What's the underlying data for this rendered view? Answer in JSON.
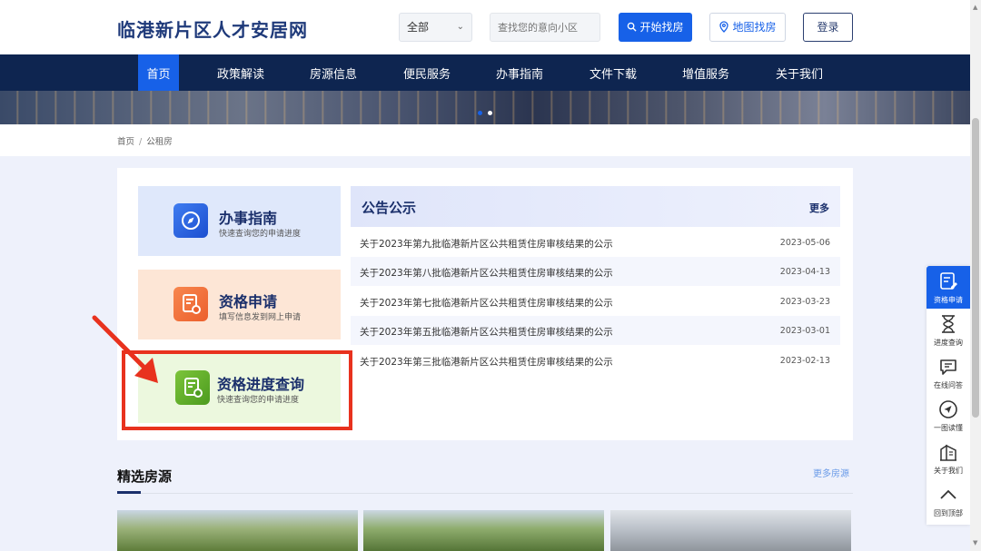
{
  "header": {
    "logo": "临港新片区人才安居网",
    "filter_value": "全部",
    "search_placeholder": "查找您的意向小区",
    "find_button": "开始找房",
    "map_button": "地图找房",
    "login_button": "登录"
  },
  "nav": {
    "items": [
      "首页",
      "政策解读",
      "房源信息",
      "便民服务",
      "办事指南",
      "文件下载",
      "增值服务",
      "关于我们"
    ],
    "active": "首页"
  },
  "breadcrumb": {
    "home": "首页",
    "separator": "/",
    "current": "公租房"
  },
  "cards": [
    {
      "title": "办事指南",
      "subtitle": "快速查询您的申请进度",
      "icon": "compass-icon",
      "bg": "#dfe8fb"
    },
    {
      "title": "资格申请",
      "subtitle": "填写信息发到网上申请",
      "icon": "certificate-icon",
      "bg": "#fde6d6"
    },
    {
      "title": "资格进度查询",
      "subtitle": "快速查询您的申请进度",
      "icon": "certificate-icon",
      "bg": "#ecf8de"
    }
  ],
  "notice": {
    "title": "公告公示",
    "more": "更多",
    "items": [
      {
        "text": "关于2023年第九批临港新片区公共租赁住房审核结果的公示",
        "date": "2023-05-06"
      },
      {
        "text": "关于2023年第八批临港新片区公共租赁住房审核结果的公示",
        "date": "2023-04-13"
      },
      {
        "text": "关于2023年第七批临港新片区公共租赁住房审核结果的公示",
        "date": "2023-03-23"
      },
      {
        "text": "关于2023年第五批临港新片区公共租赁住房审核结果的公示",
        "date": "2023-03-01"
      },
      {
        "text": "关于2023年第三批临港新片区公共租赁住房审核结果的公示",
        "date": "2023-02-13"
      }
    ]
  },
  "featured": {
    "title": "精选房源",
    "more": "更多房源"
  },
  "sidebar": {
    "items": [
      {
        "label": "资格申请",
        "icon": "form-edit-icon"
      },
      {
        "label": "进度查询",
        "icon": "hourglass-icon"
      },
      {
        "label": "在线问答",
        "icon": "chat-icon"
      },
      {
        "label": "一图读懂",
        "icon": "send-icon"
      },
      {
        "label": "关于我们",
        "icon": "building-icon"
      },
      {
        "label": "回到顶部",
        "icon": "chevron-up-icon"
      }
    ]
  },
  "colors": {
    "brand": "#1761e8",
    "nav_bg": "#0e2550",
    "title": "#1a2f6b",
    "highlight": "#e8321e"
  }
}
